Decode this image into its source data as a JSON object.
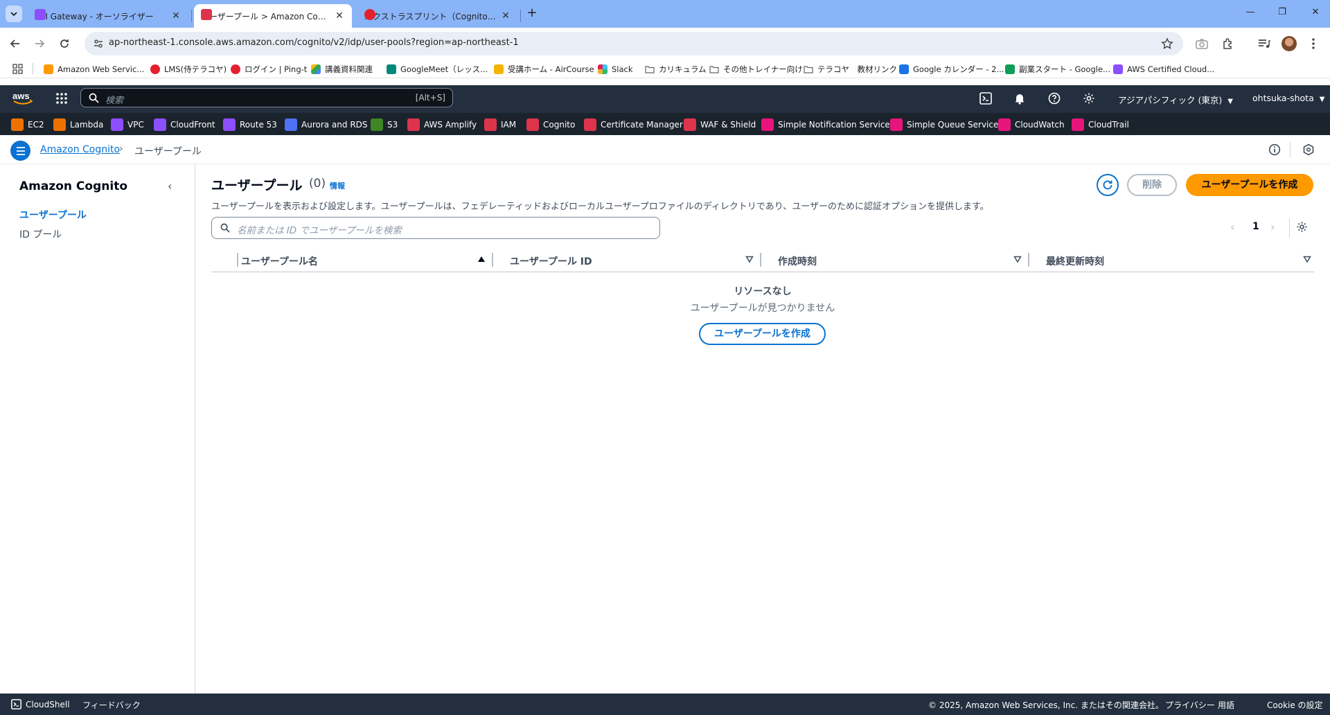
{
  "browser": {
    "tabs": [
      {
        "title": "API Gateway - オーソライザー",
        "favicon_color": "#8c4fff"
      },
      {
        "title": "ユーザープール > Amazon Cognito",
        "favicon_color": "#dd344c"
      },
      {
        "title": "エクストラスプリント（Cognito）| コ",
        "favicon_color": "#e5202e"
      }
    ],
    "url": "ap-northeast-1.console.aws.amazon.com/cognito/v2/idp/user-pools?region=ap-northeast-1",
    "bookmarks": [
      {
        "label": "Amazon Web Servic...",
        "icon": "aws-cube-icon",
        "color": "#ff9900"
      },
      {
        "label": "LMS(侍テラコヤ)",
        "icon": "samurai-icon",
        "color": "#e5202e"
      },
      {
        "label": "ログイン | Ping-t",
        "icon": "ping-icon",
        "color": "#e5202e"
      },
      {
        "label": "講義資料関連",
        "icon": "google-drive-icon",
        "color": "#34a853"
      },
      {
        "label": "GoogleMeet（レッス...",
        "icon": "google-meet-icon",
        "color": "#00897b"
      },
      {
        "label": "受講ホーム - AirCourse",
        "icon": "aircourse-icon",
        "color": "#f4b400"
      },
      {
        "label": "Slack",
        "icon": "slack-icon",
        "color": "#4a154b"
      },
      {
        "label": "カリキュラム",
        "icon": "folder-icon",
        "color": "#5f6368"
      },
      {
        "label": "その他トレイナー向け",
        "icon": "folder-icon",
        "color": "#5f6368"
      },
      {
        "label": "テラコヤ　教材リンク",
        "icon": "folder-icon",
        "color": "#5f6368"
      },
      {
        "label": "Google カレンダー - 2...",
        "icon": "google-calendar-icon",
        "color": "#1a73e8"
      },
      {
        "label": "副業スタート - Google...",
        "icon": "google-sheets-icon",
        "color": "#0f9d58"
      },
      {
        "label": "AWS Certified Cloud...",
        "icon": "aws-cert-icon",
        "color": "#8c4fff"
      }
    ]
  },
  "aws": {
    "search_placeholder": "検索",
    "search_shortcut": "[Alt+S]",
    "region": "アジアパシフィック (東京)",
    "account": "ohtsuka-shota",
    "services": [
      {
        "label": "EC2",
        "color": "#ed7100"
      },
      {
        "label": "Lambda",
        "color": "#ed7100"
      },
      {
        "label": "VPC",
        "color": "#8c4fff"
      },
      {
        "label": "CloudFront",
        "color": "#8c4fff"
      },
      {
        "label": "Route 53",
        "color": "#8c4fff"
      },
      {
        "label": "Aurora and RDS",
        "color": "#4d72f3"
      },
      {
        "label": "S3",
        "color": "#3f8624"
      },
      {
        "label": "AWS Amplify",
        "color": "#dd344c"
      },
      {
        "label": "IAM",
        "color": "#dd344c"
      },
      {
        "label": "Cognito",
        "color": "#dd344c"
      },
      {
        "label": "Certificate Manager",
        "color": "#dd344c"
      },
      {
        "label": "WAF & Shield",
        "color": "#dd344c"
      },
      {
        "label": "Simple Notification Service",
        "color": "#e7157b"
      },
      {
        "label": "Simple Queue Service",
        "color": "#e7157b"
      },
      {
        "label": "CloudWatch",
        "color": "#e7157b"
      },
      {
        "label": "CloudTrail",
        "color": "#e7157b"
      }
    ]
  },
  "breadcrumb": {
    "service": "Amazon Cognito",
    "current": "ユーザープール"
  },
  "sidenav": {
    "title": "Amazon Cognito",
    "items": [
      "ユーザープール",
      "ID プール"
    ]
  },
  "main": {
    "title": "ユーザープール",
    "count": "(0)",
    "info": "情報",
    "description": "ユーザープールを表示および設定します。ユーザープールは、フェデレーティッドおよびローカルユーザープロファイルのディレクトリであり、ユーザーのために認証オプションを提供します。",
    "delete_label": "削除",
    "create_label": "ユーザープールを作成",
    "search_placeholder": "名前または ID でユーザープールを検索",
    "page": "1",
    "columns": [
      "ユーザープール名",
      "ユーザープール ID",
      "作成時刻",
      "最終更新時刻"
    ],
    "empty_title": "リソースなし",
    "empty_subtitle": "ユーザープールが見つかりません",
    "empty_create_label": "ユーザープールを作成"
  },
  "footer": {
    "cloudshell": "CloudShell",
    "feedback": "フィードバック",
    "copyright": "© 2025, Amazon Web Services, Inc. またはその関連会社。",
    "privacy": "プライバシー",
    "terms": "用語",
    "cookies": "Cookie の設定"
  }
}
